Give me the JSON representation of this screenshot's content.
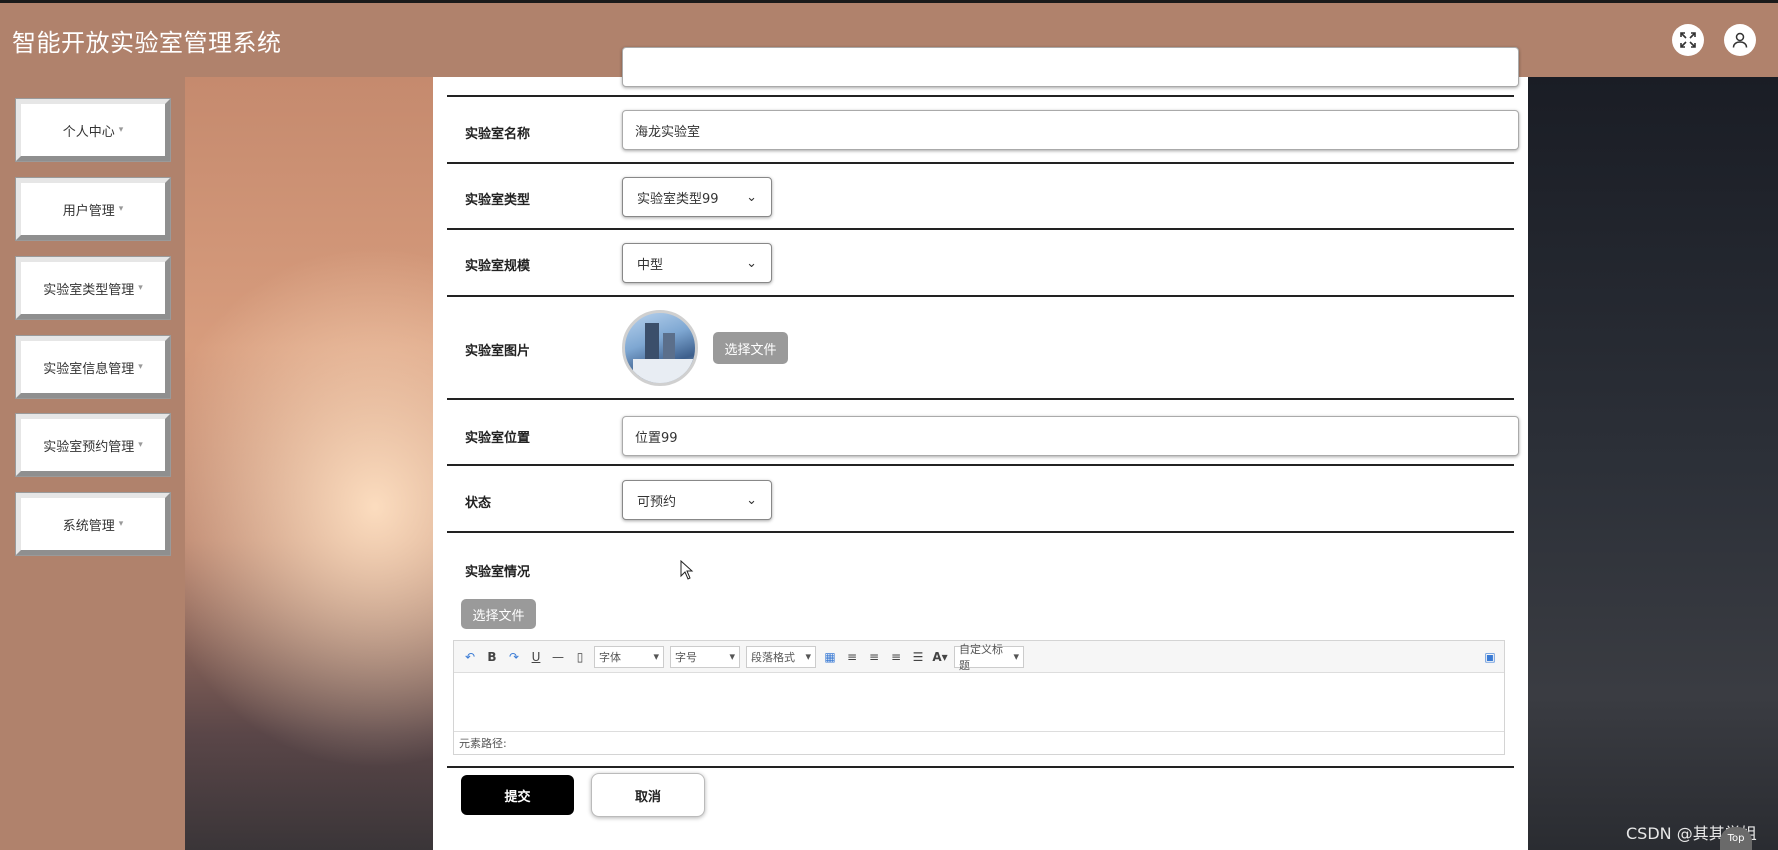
{
  "app": {
    "title": "智能开放实验室管理系统"
  },
  "topbar": {
    "fullscreen_icon": "expand-icon",
    "user_icon": "user-icon"
  },
  "sidebar": {
    "items": [
      {
        "label": "个人中心"
      },
      {
        "label": "用户管理"
      },
      {
        "label": "实验室类型管理"
      },
      {
        "label": "实验室信息管理"
      },
      {
        "label": "实验室预约管理"
      },
      {
        "label": "系统管理"
      }
    ]
  },
  "form": {
    "name": {
      "label": "实验室名称",
      "value": "海龙实验室"
    },
    "type": {
      "label": "实验室类型",
      "value": "实验室类型99"
    },
    "scale": {
      "label": "实验室规模",
      "value": "中型"
    },
    "image": {
      "label": "实验室图片",
      "button": "选择文件"
    },
    "location": {
      "label": "实验室位置",
      "value": "位置99"
    },
    "status": {
      "label": "状态",
      "value": "可预约"
    },
    "details": {
      "label": "实验室情况",
      "button": "选择文件",
      "editor": {
        "font_family": "字体",
        "font_size": "字号",
        "paragraph": "段落格式",
        "custom_title": "自定义标题",
        "path_label": "元素路径:"
      }
    },
    "submit": "提交",
    "cancel": "取消"
  },
  "watermark": "CSDN @其其学姐",
  "top_badge": "Top"
}
